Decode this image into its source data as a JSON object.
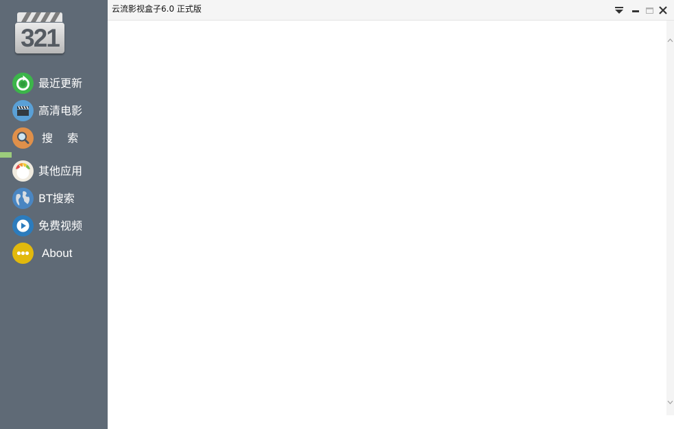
{
  "window": {
    "title": "云流影视盒子6.0  正式版"
  },
  "logo": {
    "text": "321"
  },
  "sidebar": {
    "items": [
      {
        "label": "最近更新",
        "icon": "refresh-icon",
        "color": "#3cb54a"
      },
      {
        "label": "高清电影",
        "icon": "clapperboard-icon",
        "color": "#5aa0d6"
      },
      {
        "label": "搜 索",
        "icon": "search-icon",
        "color": "#e0904a"
      },
      {
        "label": "其他应用",
        "icon": "apps-icon",
        "color": "#f0ebe0"
      },
      {
        "label": "BT搜索",
        "icon": "globe-icon",
        "color": "#4a86c2"
      },
      {
        "label": "免费视频",
        "icon": "play-icon",
        "color": "#2c7cbd"
      },
      {
        "label": "About",
        "icon": "more-dots-icon",
        "color": "#e2b90d"
      }
    ],
    "active_marker_color": "#9ccc7c"
  },
  "colors": {
    "sidebar_bg": "#5f6a76",
    "titlebar_bg": "#f5f5f5",
    "content_bg": "#ffffff"
  }
}
